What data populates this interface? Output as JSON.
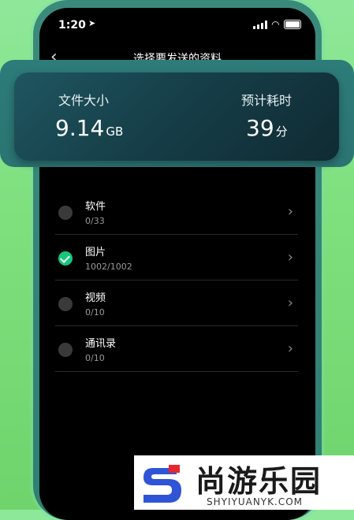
{
  "status_bar": {
    "time": "1:20"
  },
  "nav": {
    "title": "选择要发送的资料"
  },
  "summary": {
    "size_label": "文件大小",
    "size_value": "9.14",
    "size_unit": "GB",
    "time_label": "预计耗时",
    "time_value": "39",
    "time_unit": "分"
  },
  "items": [
    {
      "title": "软件",
      "count": "0/33",
      "checked": false
    },
    {
      "title": "图片",
      "count": "1002/1002",
      "checked": true
    },
    {
      "title": "视频",
      "count": "0/10",
      "checked": false
    },
    {
      "title": "通讯录",
      "count": "0/10",
      "checked": false
    }
  ],
  "watermark": {
    "text": "尚游乐园",
    "url": "SHYIYUANYK.COM"
  },
  "colors": {
    "accent_green": "#17c77a",
    "card_bg": "#163f49"
  }
}
